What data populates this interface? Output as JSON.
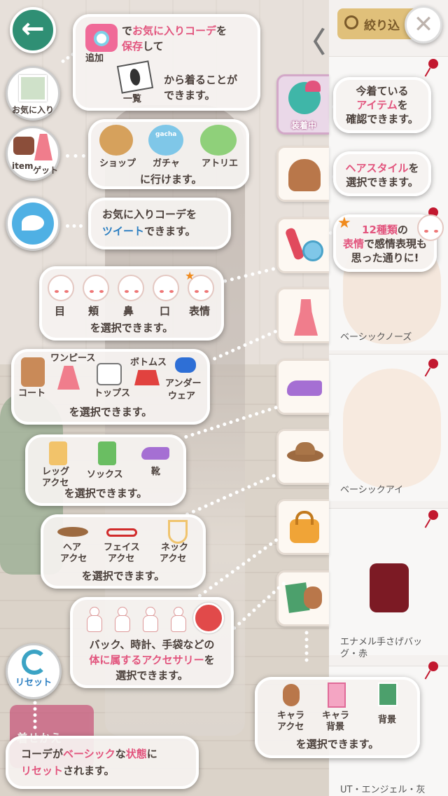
{
  "top": {
    "filter_label": "絞り込",
    "close_symbol": "✕",
    "back_symbol": "←",
    "collapse_symbol": "〈"
  },
  "left_buttons": {
    "favorite": "お気に入り",
    "item_get_1": "item",
    "item_get_2": "ゲット",
    "reset": "リセット",
    "kisekae": "着せかえ"
  },
  "tabs": {
    "equipped": "装着中"
  },
  "panel": {
    "items": [
      "ベーシックノーズ",
      "ベーシックアイ",
      "エナメル手さげバッ",
      "グ・赤",
      "UT・エンジェル・灰"
    ]
  },
  "bubbles": {
    "favorite": {
      "l1a": "で",
      "l1b": "お気に入りコーデ",
      "l1c": "を",
      "l2": "保存",
      "l2b": "して",
      "add": "追加",
      "list": "一覧",
      "l3": "から着ることが",
      "l4": "できます。"
    },
    "shop": {
      "shop": "ショップ",
      "gacha": "ガチャ",
      "atelier": "アトリエ",
      "gacha_sign": "gacha",
      "line": "に行けます。"
    },
    "tweet": {
      "l1": "お気に入りコーデを",
      "l2a": "ツイート",
      "l2b": "できます。"
    },
    "wearing": {
      "l1": "今着ている",
      "l2a": "アイテム",
      "l2b": "を",
      "l3": "確認できます。"
    },
    "hair": {
      "l1a": "ヘアスタイル",
      "l1b": "を",
      "l2": "選択できます。"
    },
    "expr": {
      "l1a": "12種類",
      "l1b": "の",
      "l2a": "表情",
      "l2b": "で感情表現も",
      "l3": "思った通りに!"
    },
    "face": {
      "eye": "目",
      "cheek": "頬",
      "nose": "鼻",
      "mouth": "口",
      "expression": "表情",
      "line": "を選択できます。"
    },
    "clothes": {
      "coat": "コート",
      "onepiece": "ワンピース",
      "tops": "トップス",
      "bottoms": "ボトムス",
      "under1": "アンダー",
      "under2": "ウェア",
      "line": "を選択できます。"
    },
    "legs": {
      "leg1": "レッグ",
      "leg2": "アクセ",
      "socks": "ソックス",
      "shoes": "靴",
      "line": "を選択できます。"
    },
    "acc": {
      "hair1": "ヘア",
      "hair2": "アクセ",
      "face1": "フェイス",
      "face2": "アクセ",
      "neck1": "ネック",
      "neck2": "アクセ",
      "line": "を選択できます。"
    },
    "body": {
      "l1": "バック、時計、手袋などの",
      "l2a": "体に属するアクセサリー",
      "l2b": "を",
      "l3": "選択できます。"
    },
    "chara": {
      "c1a": "キャラ",
      "c1b": "アクセ",
      "c2a": "キャラ",
      "c2b": "背景",
      "bg": "背景",
      "line": "を選択できます。"
    },
    "reset": {
      "l1a": "コーデが",
      "l1b": "ベーシック",
      "l1c": "な",
      "l1d": "状態",
      "l1e": "に",
      "l2a": "リセット",
      "l2b": "されます。"
    }
  },
  "colors": {
    "accent_pink": "#e2547d",
    "accent_blue": "#2b7ec1",
    "back_green": "#2f8f74",
    "pin_red": "#c2182f"
  }
}
